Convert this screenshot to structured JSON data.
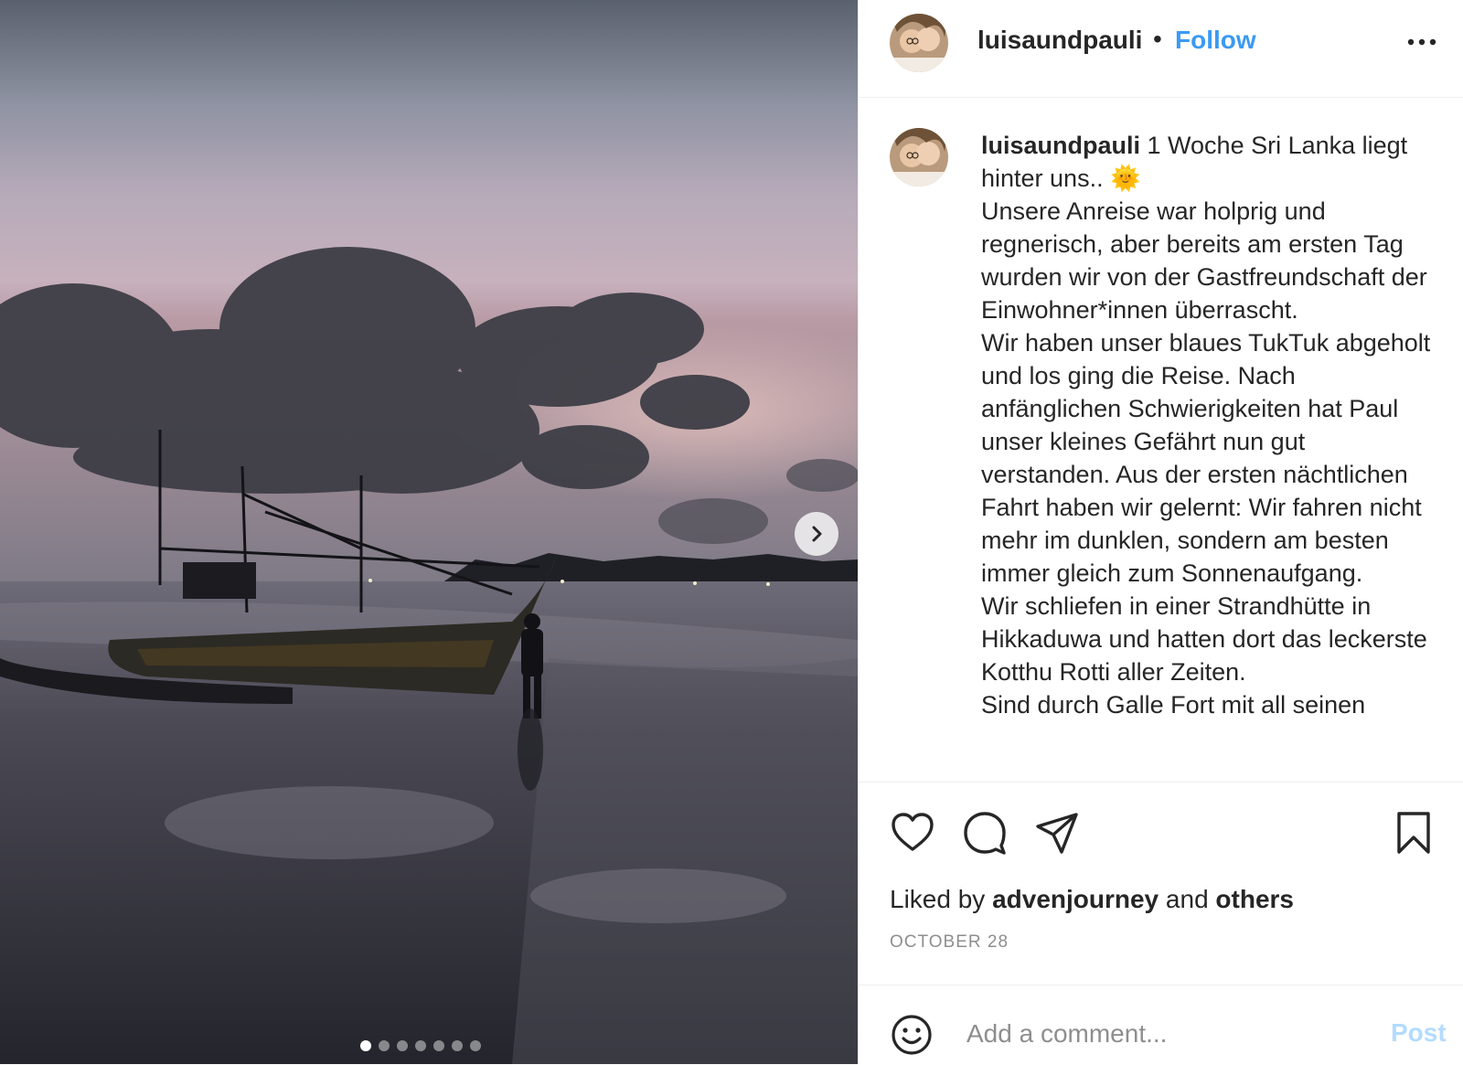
{
  "post": {
    "username": "luisaundpauli",
    "separator": "•",
    "follow_label": "Follow",
    "more_icon": "more-options-icon",
    "carousel": {
      "slide_count": 7,
      "active_index": 0
    },
    "caption": {
      "username": "luisaundpauli",
      "text": " 1 Woche Sri Lanka liegt hinter uns.. 🌞\nUnsere Anreise war holprig und regnerisch, aber bereits am ersten Tag wurden wir von der Gastfreundschaft der Einwohner*innen überrascht.\nWir haben unser blaues TukTuk abgeholt und los ging die Reise. Nach anfänglichen Schwierigkeiten hat Paul unser kleines Gefährt nun gut verstanden. Aus der ersten nächtlichen Fahrt haben wir gelernt: Wir fahren nicht mehr im dunklen, sondern am besten immer gleich zum Sonnenaufgang.\nWir schliefen in einer Strandhütte in Hikkaduwa und hatten dort das leckerste Kotthu Rotti aller Zeiten.\nSind durch Galle Fort mit all seinen"
    },
    "likes": {
      "prefix": "Liked by ",
      "user": "advenjourney",
      "middle": " and ",
      "others": "others"
    },
    "date": "OCTOBER 28",
    "comment": {
      "placeholder": "Add a comment...",
      "post_label": "Post"
    }
  },
  "colors": {
    "follow": "#3b9af2",
    "post_disabled": "#b3dbff",
    "muted": "#8e8e8e",
    "text": "#262626"
  }
}
